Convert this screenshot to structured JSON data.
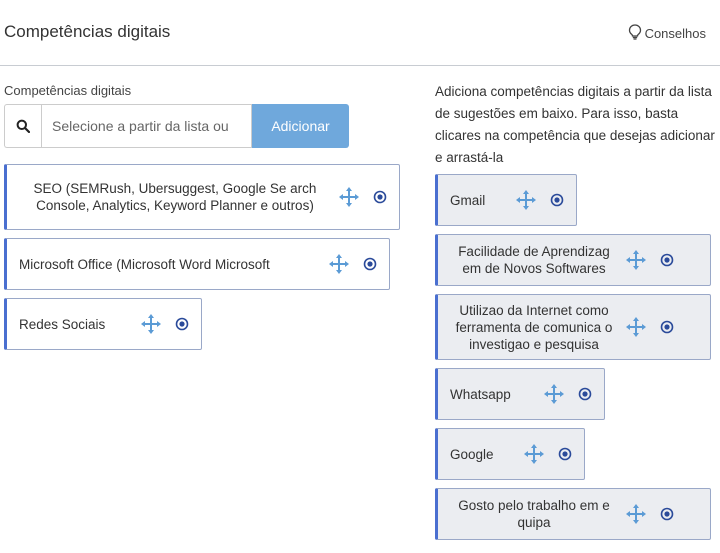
{
  "header": {
    "title": "Competências digitais",
    "tips_label": "Conselhos",
    "tips_icon": "lightbulb-icon"
  },
  "field": {
    "label": "Competências digitais",
    "search_placeholder": "Selecione a partir da lista ou",
    "search_icon": "search-icon",
    "add_label": "Adicionar"
  },
  "selected": [
    {
      "label": "SEO (SEMRush, Ubersuggest, Google Se arch Console, Analytics, Keyword Planner e outros)"
    },
    {
      "label": "Microsoft Office (Microsoft Word Microsoft"
    },
    {
      "label": "Redes Sociais"
    }
  ],
  "instructions": "Adiciona competências digitais a partir da lista de sugestões em baixo. Para isso, basta clicares na competência que desejas adicionar e arrastá-la",
  "suggestions": [
    {
      "label": "Gmail"
    },
    {
      "label": "Facilidade de Aprendizag em de Novos Softwares"
    },
    {
      "label": "Utilizao da Internet como ferramenta de comunica o investigao e pesquisa"
    },
    {
      "label": "Whatsapp"
    },
    {
      "label": "Google"
    },
    {
      "label": "Gosto pelo trabalho em e quipa"
    }
  ],
  "colors": {
    "accent": "#6fa8dc",
    "chip_border_left": "#4a6fd0",
    "icon_blue": "#5b9bd5",
    "remove_icon": "#2a4a9a"
  }
}
